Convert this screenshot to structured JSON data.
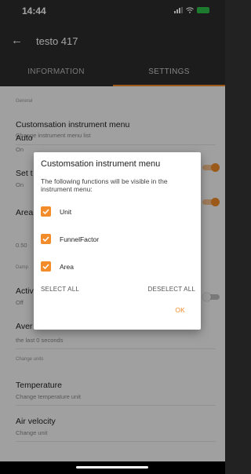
{
  "status": {
    "time": "14:44"
  },
  "appbar": {
    "title": "testo 417"
  },
  "tabs": [
    {
      "label": "INFORMATION"
    },
    {
      "label": "SETTINGS"
    }
  ],
  "settings": {
    "general_header": "General",
    "rows": [
      {
        "title": "Customsation instrument menu",
        "subtitle": "Change instrument menu list"
      },
      {
        "title": "Auto",
        "subtitle": "On"
      },
      {
        "title": "Set t",
        "subtitle": "On"
      },
      {
        "title": "Area",
        "subtitle": "0.50"
      },
      {
        "title": "Activ",
        "subtitle": "Off"
      },
      {
        "title": "Aver",
        "subtitle": "the last 0 seconds"
      },
      {
        "title": "Temperature",
        "subtitle": "Change temperature unit"
      },
      {
        "title": "Air velocity",
        "subtitle": "Change unit"
      }
    ],
    "damping_header": "Damp",
    "units_header": "Change units"
  },
  "dialog": {
    "title": "Customsation instrument menu",
    "description": "The following functions will be visible in the instrument menu:",
    "options": [
      {
        "label": "Unit",
        "checked": true
      },
      {
        "label": "FunnelFactor",
        "checked": true
      },
      {
        "label": "Area",
        "checked": true
      }
    ],
    "select_all": "SELECT ALL",
    "deselect_all": "DESELECT ALL",
    "ok": "OK"
  },
  "colors": {
    "accent": "#f28c2a",
    "appbar": "#2c2c2c",
    "background": "#fafafa"
  },
  "icons": [
    "back-arrow-icon",
    "cellular-signal-icon",
    "wifi-icon",
    "battery-icon",
    "checkbox-checked-icon"
  ]
}
